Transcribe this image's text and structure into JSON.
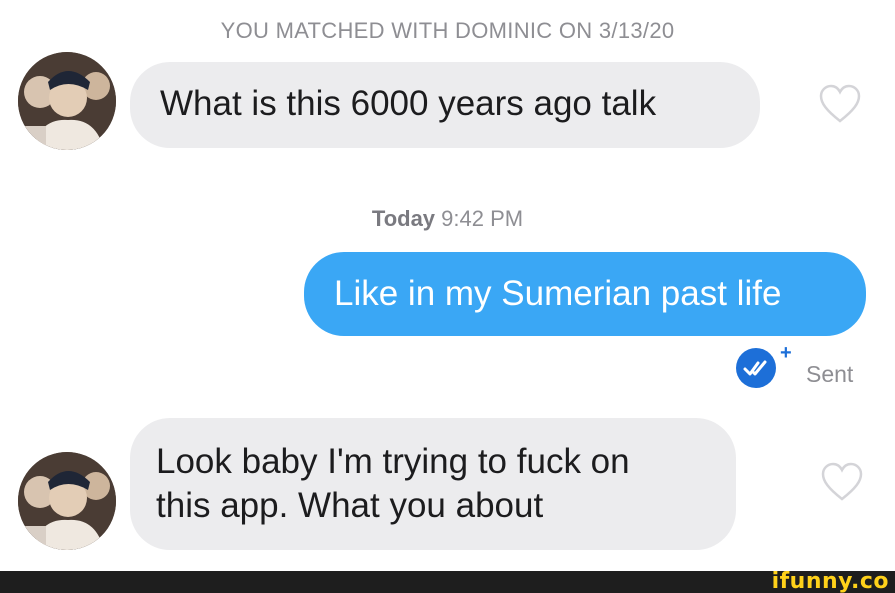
{
  "conversation": {
    "match_header": "YOU MATCHED WITH DOMINIC ON 3/13/20",
    "timestamp_day": "Today",
    "timestamp_time": "9:42 PM",
    "messages": [
      {
        "direction": "incoming",
        "text": "What is this 6000 years ago talk"
      },
      {
        "direction": "outgoing",
        "text": "Like in my Sumerian past life"
      },
      {
        "direction": "incoming",
        "line1": "Look baby I'm trying to fuck on",
        "line2": "this app. What you about"
      }
    ],
    "sent_status": "Sent",
    "sent_plus": "+"
  },
  "footer": {
    "watermark": "ifunny.co"
  },
  "colors": {
    "incoming_bubble": "#ececee",
    "outgoing_bubble": "#3aa7f5",
    "badge": "#1d6fd8",
    "watermark": "#ffd11a"
  },
  "icons": {
    "like": "heart-outline-icon",
    "read_receipt": "double-check-icon",
    "profile": "avatar-photo"
  }
}
